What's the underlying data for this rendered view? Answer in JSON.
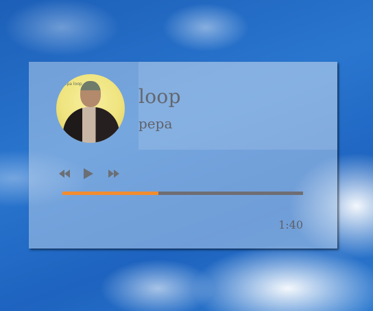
{
  "track": {
    "title": "loop",
    "artist": "pepa",
    "time": "1:40",
    "progress_fraction": 0.4
  },
  "cover": {
    "caption": "pepa loop"
  },
  "controls": {
    "previous_icon": "rewind-icon",
    "play_icon": "play-icon",
    "next_icon": "fast-forward-icon"
  },
  "colors": {
    "progress_fill": "#f28c2f",
    "progress_track": "#6e6e73",
    "text": "#63676e"
  }
}
